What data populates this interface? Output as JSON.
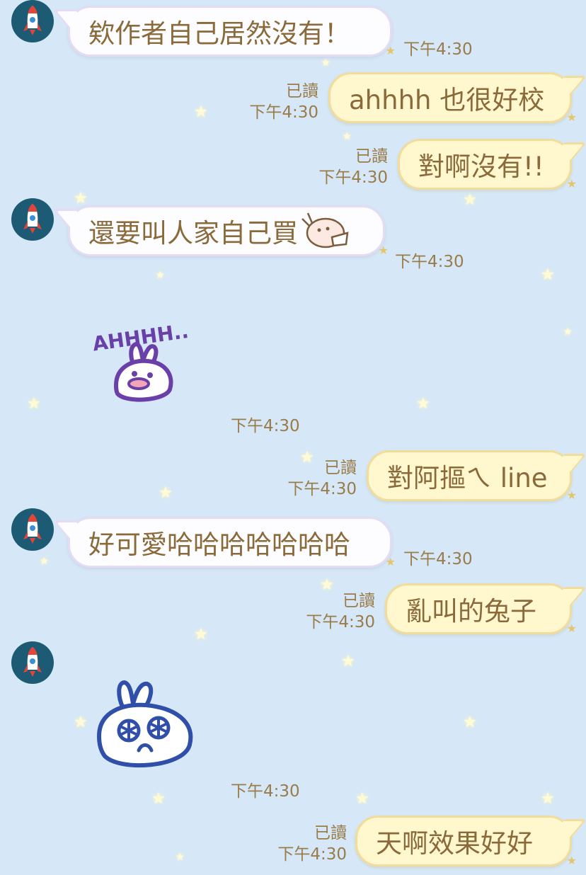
{
  "chat": {
    "messages": [
      {
        "side": "in",
        "text": "欸作者自己居然沒有！",
        "time": "下午4:30"
      },
      {
        "side": "out",
        "text": "ahhhh 也很好校",
        "read": "已讀",
        "time": "下午4:30"
      },
      {
        "side": "out",
        "text": "對啊沒有!!",
        "read": "已讀",
        "time": "下午4:30"
      },
      {
        "side": "in",
        "text": "還要叫人家自己買",
        "time": "下午4:30"
      },
      {
        "side": "in",
        "sticker": "ahhhh-rabbit-sticker",
        "sticker_text": "AHHHH..",
        "time": "下午4:30"
      },
      {
        "side": "out",
        "text": "對阿摳ㄟ line",
        "read": "已讀",
        "time": "下午4:30"
      },
      {
        "side": "in",
        "text": "好可愛哈哈哈哈哈哈哈",
        "time": "下午4:30"
      },
      {
        "side": "out",
        "text": "亂叫的兔子",
        "read": "已讀",
        "time": "下午4:30"
      },
      {
        "side": "in",
        "sticker": "dizzy-rabbit-sticker",
        "time": "下午4:30"
      },
      {
        "side": "out",
        "text": "天啊效果好好",
        "read": "已讀",
        "time": "下午4:30"
      }
    ]
  },
  "colors": {
    "background": "#d6e8f7",
    "avatar": "#1d5b74",
    "text": "#8a6a3a",
    "incoming": "#fdfdff",
    "outgoing": "#fff8cf",
    "sticker": "#6b3fa8"
  },
  "icons": {
    "avatar": "rocket-icon",
    "decor": "star-icon"
  }
}
